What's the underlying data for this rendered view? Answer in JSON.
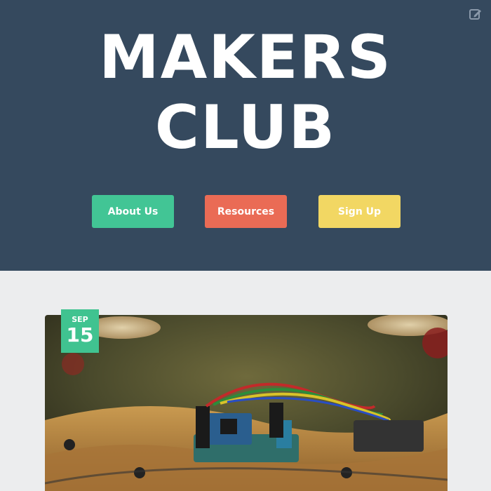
{
  "hero": {
    "title_line1": "MAKERS",
    "title_line2": "CLUB",
    "background_color": "#35495e",
    "edit_icon": "edit-icon"
  },
  "buttons": {
    "about": {
      "label": "About Us",
      "color": "#42c595"
    },
    "resources": {
      "label": "Resources",
      "color": "#ea6b55"
    },
    "signup": {
      "label": "Sign Up",
      "color": "#f2d763"
    }
  },
  "post": {
    "date_month": "SEP",
    "date_day": "15",
    "date_color": "#40c390",
    "image": "electronics-circuit-board-photo"
  }
}
